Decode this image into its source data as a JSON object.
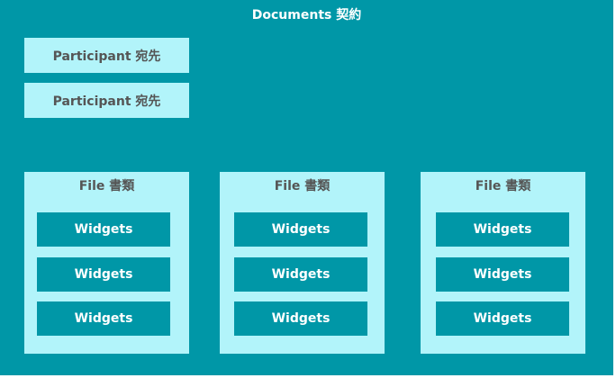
{
  "diagram": {
    "title": "Documents 契約",
    "participants": [
      "Participant 宛先",
      "Participant 宛先"
    ],
    "files": [
      {
        "label": "File 書類",
        "widgets": [
          "Widgets",
          "Widgets",
          "Widgets"
        ]
      },
      {
        "label": "File 書類",
        "widgets": [
          "Widgets",
          "Widgets",
          "Widgets"
        ]
      },
      {
        "label": "File 書類",
        "widgets": [
          "Widgets",
          "Widgets",
          "Widgets"
        ]
      }
    ],
    "colors": {
      "background": "#0097a7",
      "box": "#b2f4fa",
      "box_text": "#555555",
      "title_text": "#ffffff"
    }
  }
}
